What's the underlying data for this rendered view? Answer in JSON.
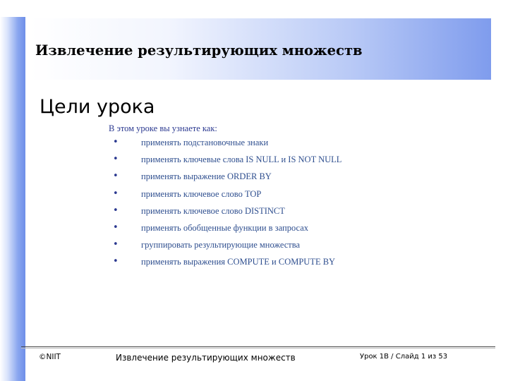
{
  "slide": {
    "title": "Извлечение результирующих множеств",
    "section_heading": "Цели урока",
    "intro": "В этом уроке вы узнаете как:",
    "bullet_symbol": "•",
    "bullets": [
      "применять подстановочные знаки",
      "применять ключевые слова IS NULL и IS NOT NULL",
      "применять выражение ORDER BY",
      "применять ключевое слово TOP",
      "применять ключевое слово DISTINCT",
      "применять обобщенные функции в запросах",
      "группировать результирующие множества",
      "применять выражения COMPUTE и COMPUTE BY"
    ]
  },
  "footer": {
    "copyright": "©NIIT",
    "title": "Извлечение результирующих множеств",
    "slide_info": "Урок 1B / Слайд 1 из 53"
  },
  "colors": {
    "accent_blue": "#6e8fe8",
    "bullet_text": "#2f4f8f"
  }
}
